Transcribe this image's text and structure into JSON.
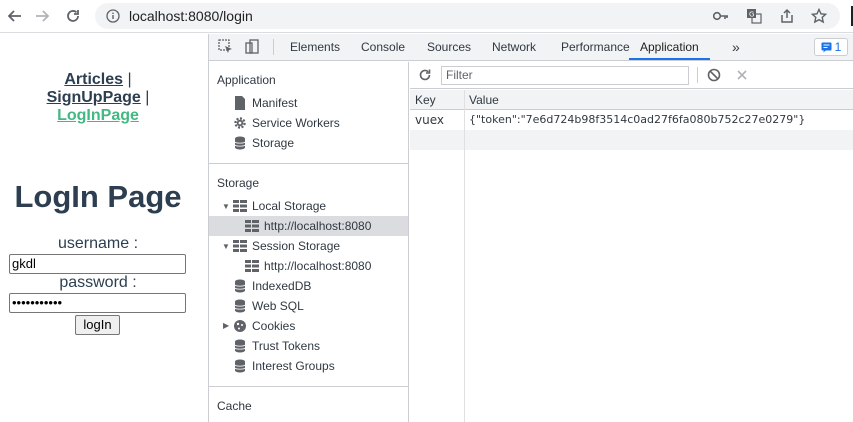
{
  "browser": {
    "url": "localhost:8080/login",
    "icons": [
      "back-icon",
      "forward-icon",
      "reload-icon",
      "info-icon",
      "key-icon",
      "translate-icon",
      "share-icon",
      "star-icon"
    ]
  },
  "page": {
    "nav": {
      "articles": "Articles",
      "signup": "SignUpPage",
      "login": "LogInPage",
      "separator": "|"
    },
    "title": "LogIn Page",
    "username_label": "username :",
    "username_value": "gkdl",
    "password_label": "password :",
    "password_value": "•••••••••••",
    "login_button": "logIn",
    "active_link_color": "#42b983"
  },
  "devtools": {
    "tabs": [
      "Elements",
      "Console",
      "Sources",
      "Network",
      "Performance",
      "Application"
    ],
    "active_tab": "Application",
    "more_tabs": "»",
    "issues_count": "1",
    "accent_color": "#1a73e8",
    "sidebar": {
      "application_title": "Application",
      "application_items": [
        "Manifest",
        "Service Workers",
        "Storage"
      ],
      "storage_title": "Storage",
      "local_storage": "Local Storage",
      "local_storage_origin": "http://localhost:8080",
      "session_storage": "Session Storage",
      "session_storage_origin": "http://localhost:8080",
      "storage_items": [
        "IndexedDB",
        "Web SQL",
        "Cookies",
        "Trust Tokens",
        "Interest Groups"
      ],
      "cache_title": "Cache"
    },
    "main": {
      "filter_placeholder": "Filter",
      "headers": {
        "key": "Key",
        "value": "Value"
      },
      "rows": [
        {
          "key": "vuex",
          "value": "{\"token\":\"7e6d724b98f3514c0ad27f6fa080b752c27e0279\"}"
        }
      ]
    }
  }
}
